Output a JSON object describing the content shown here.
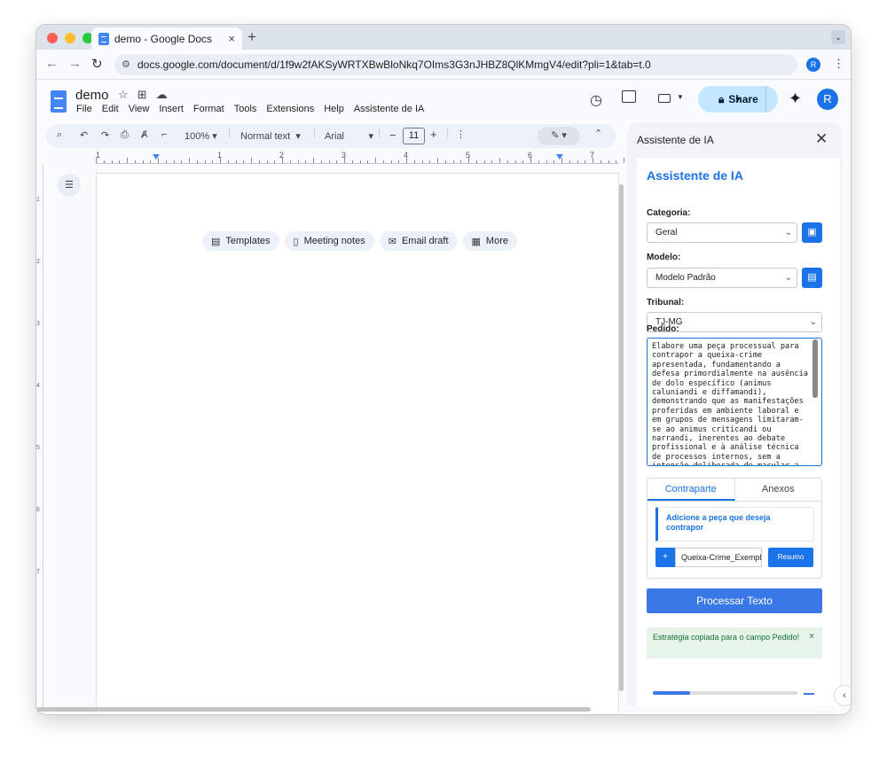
{
  "browser": {
    "tab_title": "demo - Google Docs",
    "tab_close": "×",
    "new_tab": "+",
    "url": "docs.google.com/document/d/1f9w2fAKSyWRTXBwBloNkq7OIms3G3nJHBZ8QlKMmgV4/edit?pli=1&tab=t.0",
    "profile_initial": "R"
  },
  "docs": {
    "doc_name": "demo",
    "menu": [
      "File",
      "Edit",
      "View",
      "Insert",
      "Format",
      "Tools",
      "Extensions",
      "Help",
      "Assistente de IA"
    ],
    "share_label": "Share",
    "avatar_initial": "R"
  },
  "toolbar": {
    "zoom": "100%",
    "style": "Normal text",
    "font": "Arial",
    "font_size": "11",
    "minus": "−",
    "plus": "+"
  },
  "ruler": {
    "numbers": [
      "1",
      "1",
      "2",
      "3",
      "4",
      "5",
      "6",
      "7"
    ]
  },
  "vruler": {
    "numbers": [
      "1",
      "2",
      "3",
      "4",
      "5",
      "6",
      "7"
    ]
  },
  "chips": [
    {
      "icon": "templates-icon",
      "label": "Templates"
    },
    {
      "icon": "meeting-notes-icon",
      "label": "Meeting notes"
    },
    {
      "icon": "email-draft-icon",
      "label": "Email draft"
    },
    {
      "icon": "more-icon",
      "label": "More"
    }
  ],
  "sidebar": {
    "title": "Assistente de IA",
    "heading": "Assistente de IA",
    "categoria_label": "Categoria:",
    "categoria_value": "Geral",
    "modelo_label": "Modelo:",
    "modelo_value": "Modelo Padrão",
    "tribunal_label": "Tribunal:",
    "tribunal_value": "TJ-MG",
    "pedido_label": "Pedido:",
    "pedido_text": "Elabore uma peça processual para contrapor a queixa-crime apresentada, fundamentando a defesa primordialmente na ausência de dolo específico (animus caluniandi e diffamandi), demonstrando que as manifestações proferidas em ambiente laboral e em grupos de mensagens limitaram-se ao animus criticandi ou narrandi, inerentes ao debate profissional e à análise técnica de processos internos, sem a intenção deliberada de macular a honra. A peça deve arguir",
    "tab_contraparte": "Contraparte",
    "tab_anexos": "Anexos",
    "notice": "Adicione a peça que deseja contrapor",
    "plus_label": "+",
    "file_name": "Queixa-Crime_Exemplo",
    "resumo_label": "Resumo",
    "process_label": "Processar Texto",
    "success_message": "Estratégia copiada para o campo Pedido!",
    "success_close": "×",
    "progress": 0.26,
    "accent": "#1a73e8"
  }
}
